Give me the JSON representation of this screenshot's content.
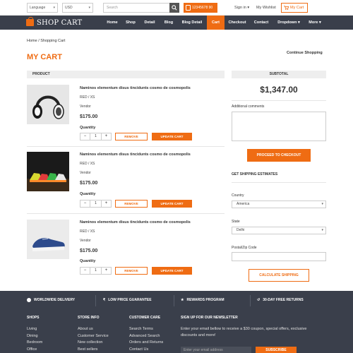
{
  "topbar": {
    "language": "Language",
    "currency": "USD",
    "search_placeholder": "Search",
    "phone": "12345678 90",
    "signin": "Sign in ▾",
    "wishlist": "My Wishlist",
    "mycart": "My Cart"
  },
  "nav": {
    "logo": "SHOP CART",
    "items": [
      "Home",
      "Shop",
      "Detail",
      "Blog",
      "Blog Detail",
      "Cart",
      "Checkout",
      "Contact",
      "Dropdown ▾",
      "More ▾"
    ],
    "active": "Cart"
  },
  "page": {
    "breadcrumb": "Home / Shopping Cart",
    "title": "MY CART",
    "continue": "Continue Shopping",
    "product_header": "PRODUCT"
  },
  "items": [
    {
      "name": "Naminos elementum disus tincidunts cosmo de cosmopolis",
      "variant": "RED / XS",
      "vendor": "Vendor",
      "price": "$175.00",
      "qty_label": "Quantity",
      "qty": "1",
      "remove": "REMOVE",
      "update": "UPDATE CART"
    },
    {
      "name": "Naminos elementum disus tincidunts cosmo de cosmopolis",
      "variant": "RED / XS",
      "vendor": "Vendor",
      "price": "$175.00",
      "qty_label": "Quantity",
      "qty": "1",
      "remove": "REMOVE",
      "update": "UPDATE CART"
    },
    {
      "name": "Naminos elementum disus tincidunts cosmo de cosmopolis",
      "variant": "RED / XS",
      "vendor": "Vendor",
      "price": "$175.00",
      "qty_label": "Quantity",
      "qty": "1",
      "remove": "REMOVE",
      "update": "UPDATE CART"
    }
  ],
  "summary": {
    "subtotal_header": "SUBTOTAL",
    "total": "$1,347.00",
    "comments_label": "Additional comments",
    "checkout": "PROCEED TO CHECKOUT",
    "ship_header": "GET SHIPPING ESTIMATES",
    "country_label": "Country",
    "country": "America",
    "state_label": "State",
    "state": "Delhi",
    "zip_label": "Postal/Zip Code",
    "calculate": "CALCULATE SHIPPING"
  },
  "footer": {
    "features": [
      "WORLDWIDE DELIVERY",
      "LOW PRICE GUARANTEE",
      "REWARDS PROGRAM",
      "30-DAY FREE RETURNS"
    ],
    "columns": [
      {
        "title": "SHOPS",
        "links": [
          "Living",
          "Dining",
          "Bedroom",
          "Office"
        ]
      },
      {
        "title": "STORE INFO",
        "links": [
          "About us",
          "Customer Service",
          "New collection",
          "Best sellers"
        ]
      },
      {
        "title": "CUSTOMER CARE",
        "links": [
          "Search Terms",
          "Advanced Search",
          "Orders and Returns",
          "Contact Us"
        ]
      }
    ],
    "newsletter_title": "SIGN UP FOR OUR NEWSLETTER",
    "newsletter_text": "Enter your email bellow to receive a $30 coupon, special offers, exclusive discounts and more!",
    "email_placeholder": "Enter your email address",
    "subscribe": "SUBSCRIBE"
  },
  "colors": {
    "accent": "#ef6c13",
    "nav_bg": "#3a3f4b"
  }
}
